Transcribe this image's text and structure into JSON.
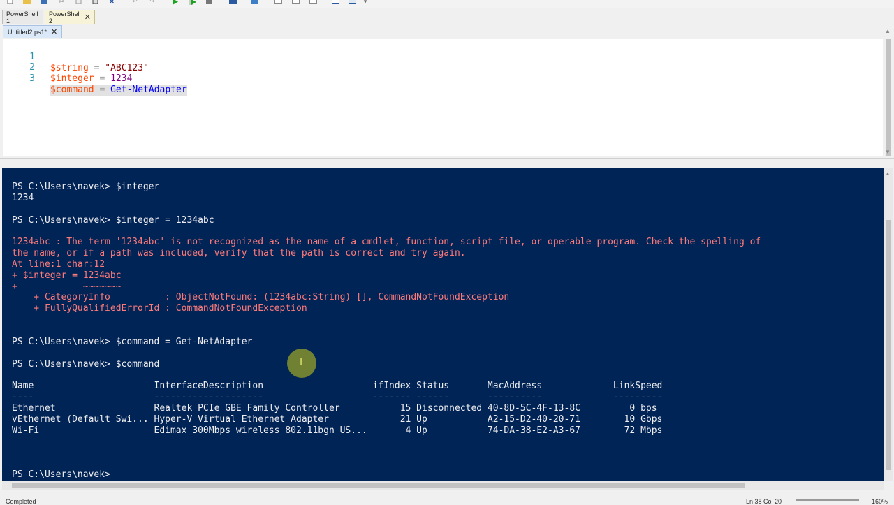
{
  "toolbar": {
    "icons": [
      "new-file-icon",
      "open-file-icon",
      "save-icon",
      "cut-icon",
      "copy-icon",
      "paste-icon",
      "clear-icon",
      "undo-icon",
      "redo-icon",
      "run-icon",
      "run-selection-icon",
      "stop-icon",
      "remote-icon",
      "debug-icon",
      "layout-icon",
      "layout-icon",
      "layout-icon",
      "show-commands-icon",
      "show-addons-icon",
      "more-icon"
    ]
  },
  "session_tabs": [
    {
      "label": "PowerShell 1",
      "active": false
    },
    {
      "label": "PowerShell 2",
      "active": true,
      "close": "✕"
    }
  ],
  "file_tab": {
    "label": "Untitled2.ps1*",
    "close": "✕"
  },
  "editor": {
    "lines": [
      {
        "num": "1",
        "var": "$string",
        "op": " = ",
        "value": "\"ABC123\"",
        "value_type": "str"
      },
      {
        "num": "2",
        "var": "$integer",
        "op": " = ",
        "value": "1234",
        "value_type": "num"
      },
      {
        "num": "3",
        "var": "$command",
        "op": " = ",
        "value": "Get-NetAdapter",
        "value_type": "cmd"
      }
    ]
  },
  "console": {
    "lines": [
      {
        "text": "PS C:\\Users\\navek> $integer",
        "type": "normal"
      },
      {
        "text": "1234",
        "type": "normal"
      },
      {
        "text": "PS C:\\Users\\navek> $integer = 1234abc",
        "type": "normal"
      },
      {
        "text": "1234abc : The term '1234abc' is not recognized as the name of a cmdlet, function, script file, or operable program. Check the spelling of",
        "type": "error"
      },
      {
        "text": "the name, or if a path was included, verify that the path is correct and try again.",
        "type": "error"
      },
      {
        "text": "At line:1 char:12",
        "type": "error"
      },
      {
        "text": "+ $integer = 1234abc",
        "type": "error"
      },
      {
        "text": "+            ~~~~~~~",
        "type": "error"
      },
      {
        "text": "    + CategoryInfo          : ObjectNotFound: (1234abc:String) [], CommandNotFoundException",
        "type": "error"
      },
      {
        "text": "    + FullyQualifiedErrorId : CommandNotFoundException",
        "type": "error"
      },
      {
        "text": "PS C:\\Users\\navek> $command = Get-NetAdapter",
        "type": "normal"
      },
      {
        "text": "PS C:\\Users\\navek> $command",
        "type": "normal"
      },
      {
        "text": "Name                      InterfaceDescription                    ifIndex Status       MacAddress             LinkSpeed",
        "type": "normal"
      },
      {
        "text": "----                      --------------------                    ------- ------       ----------             ---------",
        "type": "normal"
      },
      {
        "text": "Ethernet                  Realtek PCIe GBE Family Controller           15 Disconnected 40-8D-5C-4F-13-8C         0 bps",
        "type": "normal"
      },
      {
        "text": "vEthernet (Default Swi... Hyper-V Virtual Ethernet Adapter             21 Up           A2-15-D2-40-20-71        10 Gbps",
        "type": "normal"
      },
      {
        "text": "Wi-Fi                     Edimax 300Mbps wireless 802.11bgn US...       4 Up           74-DA-38-E2-A3-67        72 Mbps",
        "type": "normal"
      },
      {
        "text": "PS C:\\Users\\navek> ",
        "type": "normal"
      }
    ]
  },
  "status": {
    "left": "Completed",
    "position": "Ln 38  Col 20",
    "zoom": "160%"
  },
  "colors": {
    "console_bg": "#012456",
    "error": "#ff7a7a",
    "editor_var": "#ff4500",
    "editor_cmd": "#0000ff"
  }
}
